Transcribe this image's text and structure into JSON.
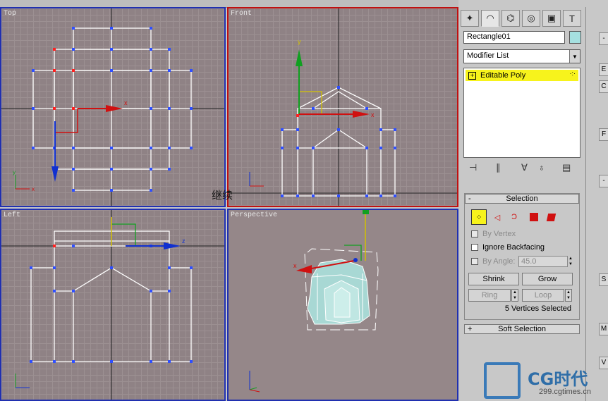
{
  "viewports": {
    "top": {
      "label": "Top"
    },
    "front": {
      "label": "Front"
    },
    "left": {
      "label": "Left"
    },
    "perspective": {
      "label": "Perspective"
    }
  },
  "axis_labels": {
    "x": "x",
    "y": "y",
    "z": "z"
  },
  "watermark_text": "继续",
  "command_panel": {
    "tabs": [
      "create-icon",
      "modify-icon",
      "hierarchy-icon",
      "motion-icon",
      "display-icon",
      "utilities-icon"
    ],
    "object_name": "Rectangle01",
    "object_color": "#a5e0e0",
    "modifier_list": "Modifier List",
    "stack_item": "Editable Poly",
    "stack_item_sign": "+"
  },
  "selection_rollout": {
    "sign": "-",
    "title": "Selection",
    "by_vertex": "By Vertex",
    "ignore_backfacing": "Ignore Backfacing",
    "by_angle": "By Angle:",
    "angle_value": "45.0",
    "shrink": "Shrink",
    "grow": "Grow",
    "ring": "Ring",
    "loop": "Loop",
    "status": "5 Vertices Selected"
  },
  "soft_selection_rollout": {
    "sign": "+",
    "title": "Soft Selection"
  },
  "right_strip": {
    "sign": "-",
    "letters": [
      "E",
      "C",
      "F",
      "S",
      "M",
      "V"
    ]
  },
  "logo": {
    "text": "CG时代",
    "url": "299.cgtimes.cn"
  },
  "colors": {
    "vertex": "#2f4fff",
    "selected_vertex": "#ff2020",
    "wire": "#ffffff",
    "x_axis": "#d01010",
    "y_axis": "#10a020",
    "z_axis": "#1030d0"
  }
}
